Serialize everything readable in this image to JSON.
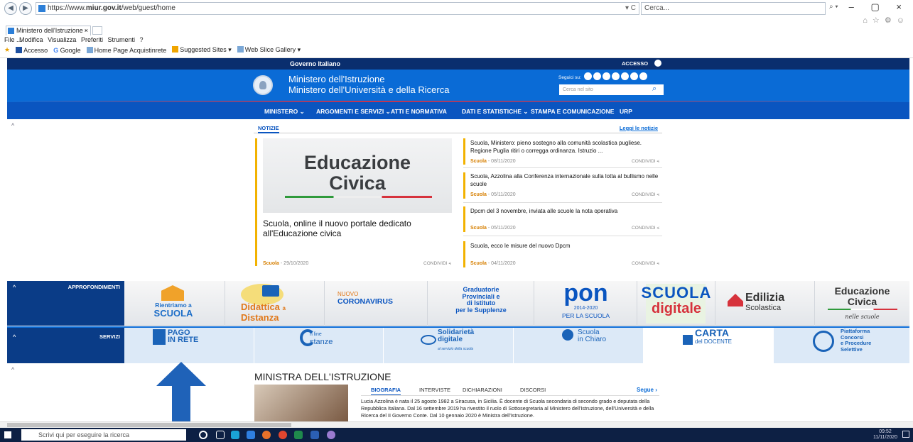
{
  "browser": {
    "url_prefix": "https://www.",
    "url_domain": "miur.gov.it",
    "url_path": "/web/guest/home",
    "address_controls": "▾ C",
    "search_placeholder": "Cerca...",
    "search_go": "⌕ ▾",
    "tab_title": "Ministero dell'Istruzione - ...",
    "tab_close": "×",
    "window_buttons": "– ▢ ×",
    "toolbar_icons": "⌂ ☆ ⚙ ☺",
    "menu": [
      "File",
      "Modifica",
      "Visualizza",
      "Preferiti",
      "Strumenti",
      "?"
    ],
    "favorites": [
      "Accesso",
      "Google",
      "Home Page Acquistinrete",
      "Suggested Sites ▾",
      "Web Slice Gallery ▾"
    ]
  },
  "site": {
    "topbar_left": "Governo Italiano",
    "topbar_right": "ACCESSO",
    "title_line1": "Ministero dell'Istruzione",
    "title_line2": "Ministero dell'Università e della Ricerca",
    "follow_label": "Seguici su:",
    "search_placeholder": "Cerca nel sito",
    "colors": {
      "header": "#0a6bd6",
      "topbar": "#0a2e6e",
      "nav": "#0a55c0",
      "accent": "#f2b200"
    },
    "nav": [
      "MINISTERO ⌄",
      "ARGOMENTI E SERVIZI ⌄",
      "ATTI E NORMATIVA",
      "DATI E STATISTICHE ⌄",
      "STAMPA E COMUNICAZIONE",
      "URP"
    ]
  },
  "news": {
    "tab_label": "NOTIZIE",
    "read_all": "Leggi le notizie",
    "featured": {
      "image_line1": "Educazione",
      "image_line2": "Civica",
      "title": "Scuola, online il nuovo portale dedicato all'Educazione civica",
      "category": "Scuola",
      "date": " - 29/10/2020",
      "share": "CONDIVIDI ⪪"
    },
    "items": [
      {
        "title": "Scuola, Ministero: pieno sostegno alla comunità scolastica pugliese. Regione Puglia ritiri o corregga ordinanza. Istruzio ...",
        "category": "Scuola",
        "date": " - 08/11/2020",
        "share": "CONDIVIDI ⪪"
      },
      {
        "title": "Scuola, Azzolina alla Conferenza internazionale sulla lotta al bullismo nelle scuole",
        "category": "Scuola",
        "date": " - 05/11/2020",
        "share": "CONDIVIDI ⪪"
      },
      {
        "title": "Dpcm del 3 novembre, inviata alle scuole la nota operativa",
        "category": "Scuola",
        "date": " - 05/11/2020",
        "share": "CONDIVIDI ⪪"
      },
      {
        "title": "Scuola, ecco le misure del nuovo Dpcm",
        "category": "Scuola",
        "date": " - 04/11/2020",
        "share": "CONDIVIDI ⪪"
      }
    ]
  },
  "approfondimenti": {
    "label": "APPROFONDIMENTI",
    "rientriamo_1": "Rientriamo a",
    "rientriamo_2": "SCUOLA",
    "didattica_1": "Didattica",
    "didattica_a": "a",
    "didattica_2": "Distanza",
    "corona_1": "NUOVO",
    "corona_2": "CORONAVIRUS",
    "grad_1": "Graduatorie",
    "grad_2": "Provinciali e",
    "grad_3": "di Istituto",
    "grad_4": "per le Supplenze",
    "pon_1": "pon",
    "pon_2": "2014-2020",
    "pon_3": "PER LA SCUOLA",
    "sd_1": "SCUOLA",
    "sd_2": "digitale",
    "edilizia_1": "Edilizia",
    "edilizia_2": "Scolastica",
    "educiv_1": "Educazione",
    "educiv_2": "Civica",
    "educiv_3": "nelle scuole"
  },
  "servizi": {
    "label": "SERVIZI",
    "pago_1": "PAGO",
    "pago_2": "IN RETE",
    "istanze_1": "n line",
    "istanze_2": "stanze",
    "solid_1": "Solidarietà",
    "solid_2": "digitale",
    "solid_3": "al servizio della scuola",
    "chiaro_1": "Scuola",
    "chiaro_2": "in Chiaro",
    "carta_1": "CARTA",
    "carta_2": "del DOCENTE",
    "piatt_1": "Piattaforma",
    "piatt_2": "Concorsi",
    "piatt_3": "e Procedure",
    "piatt_4": "Selettive"
  },
  "ministra": {
    "title": "MINISTRA DELL'ISTRUZIONE",
    "tabs": [
      "BIOGRAFIA",
      "INTERVISTE",
      "DICHIARAZIONI",
      "DISCORSI"
    ],
    "follow": "Segue ›",
    "bio": "Lucia Azzolina è nata il 25 agosto 1982 a Siracusa, in Sicilia. È docente di Scuola secondaria di secondo grado e deputata della Repubblica Italiana. Dal 16 settembre 2019 ha rivestito il ruolo di Sottosegretaria al Ministero dell'Istruzione, dell'Università e della Ricerca del II Governo Conte. Dal 10 gennaio 2020 è Ministra dell'Istruzione."
  },
  "taskbar": {
    "search_placeholder": "Scrivi qui per eseguire la ricerca",
    "time": "09:52",
    "date": "11/11/2020"
  }
}
